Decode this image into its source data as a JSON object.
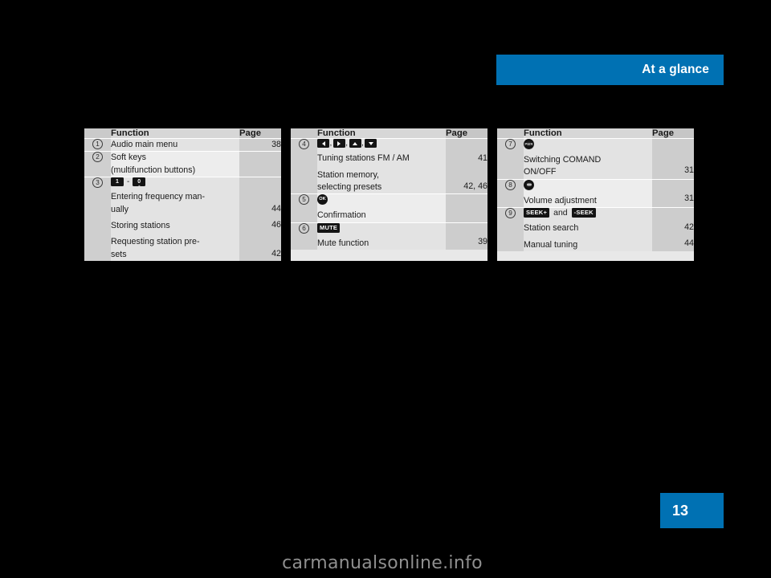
{
  "header": {
    "title": "At a glance",
    "accent_color": "#0071b3"
  },
  "page_number": "13",
  "watermark": "carmanualsonline.info",
  "columns": {
    "function": "Function",
    "page": "Page"
  },
  "tables": [
    {
      "rows": [
        {
          "index": "1",
          "lines": [
            {
              "text": "Audio main menu",
              "page": "38"
            }
          ]
        },
        {
          "index": "2",
          "lines": [
            {
              "text": "Soft keys",
              "page": ""
            },
            {
              "text": "(multifunction buttons)",
              "page": ""
            }
          ]
        },
        {
          "index": "3",
          "glyph": "number-key-range",
          "glyph_labels": {
            "from": "1",
            "to": "0",
            "to_sub": "␣",
            "dash": "-"
          },
          "lines": [
            {
              "text": "Entering frequency man-",
              "page": ""
            },
            {
              "text": "ually",
              "page": "44"
            },
            {
              "text": "Storing stations",
              "page": "46"
            },
            {
              "text": "Requesting station pre-",
              "page": ""
            },
            {
              "text": "sets",
              "page": "42"
            }
          ]
        }
      ]
    },
    {
      "rows": [
        {
          "index": "4",
          "glyph": "arrow-keys",
          "glyph_labels": {
            "keys": [
              "left",
              "right",
              "up",
              "down"
            ],
            "separator": ","
          },
          "lines": [
            {
              "text": "Tuning stations FM / AM",
              "page": "41"
            },
            {
              "text": "Station memory,",
              "page": ""
            },
            {
              "text": "selecting presets",
              "page": "42, 46"
            }
          ]
        },
        {
          "index": "5",
          "glyph": "ok-button",
          "glyph_labels": {
            "label": "OK"
          },
          "lines": [
            {
              "text": "Confirmation",
              "page": ""
            }
          ]
        },
        {
          "index": "6",
          "glyph": "mute-button",
          "glyph_labels": {
            "label": "MUTE"
          },
          "lines": [
            {
              "text": "Mute function",
              "page": "39"
            }
          ]
        }
      ]
    },
    {
      "rows": [
        {
          "index": "7",
          "glyph": "power-knob",
          "glyph_labels": {
            "label": "PWR"
          },
          "lines": [
            {
              "text": "Switching COMAND",
              "page": ""
            },
            {
              "text": "ON/OFF",
              "page": "31"
            }
          ]
        },
        {
          "index": "8",
          "glyph": "volume-knob",
          "glyph_labels": {
            "label": ""
          },
          "lines": [
            {
              "text": "Volume adjustment",
              "page": "31"
            }
          ]
        },
        {
          "index": "9",
          "glyph": "seek-buttons",
          "glyph_labels": {
            "first": "SEEK+",
            "conjunction": "and",
            "second": "-SEEK"
          },
          "lines": [
            {
              "text": "Station search",
              "page": "42"
            },
            {
              "text": "Manual tuning",
              "page": "44"
            }
          ]
        }
      ]
    }
  ]
}
